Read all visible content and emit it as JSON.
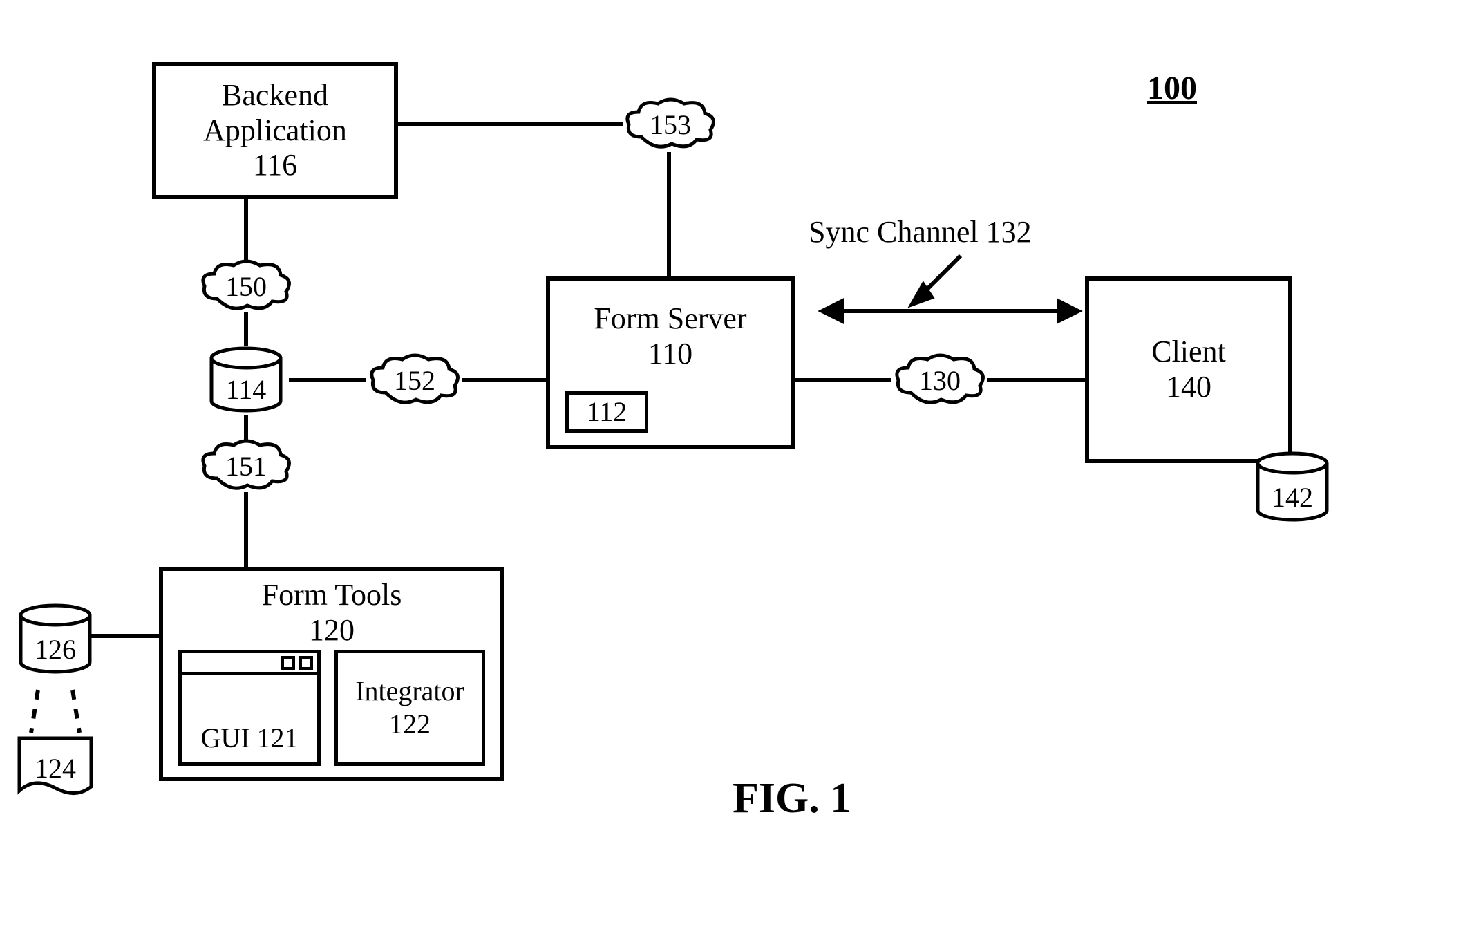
{
  "figure_number": "100",
  "figure_caption": "FIG. 1",
  "sync_channel_label": "Sync Channel 132",
  "boxes": {
    "backend_app": {
      "line1": "Backend",
      "line2": "Application",
      "ref": "116"
    },
    "form_server": {
      "line1": "Form Server",
      "ref": "110",
      "inner_ref": "112"
    },
    "client": {
      "line1": "Client",
      "ref": "140"
    },
    "form_tools": {
      "line1": "Form Tools",
      "ref": "120"
    },
    "gui": {
      "label": "GUI 121"
    },
    "integrator": {
      "line1": "Integrator",
      "ref": "122"
    }
  },
  "clouds": {
    "c150": "150",
    "c151": "151",
    "c152": "152",
    "c153": "153",
    "c130": "130"
  },
  "cylinders": {
    "db114": "114",
    "db126": "126",
    "db142": "142"
  },
  "documents": {
    "doc124": "124"
  }
}
